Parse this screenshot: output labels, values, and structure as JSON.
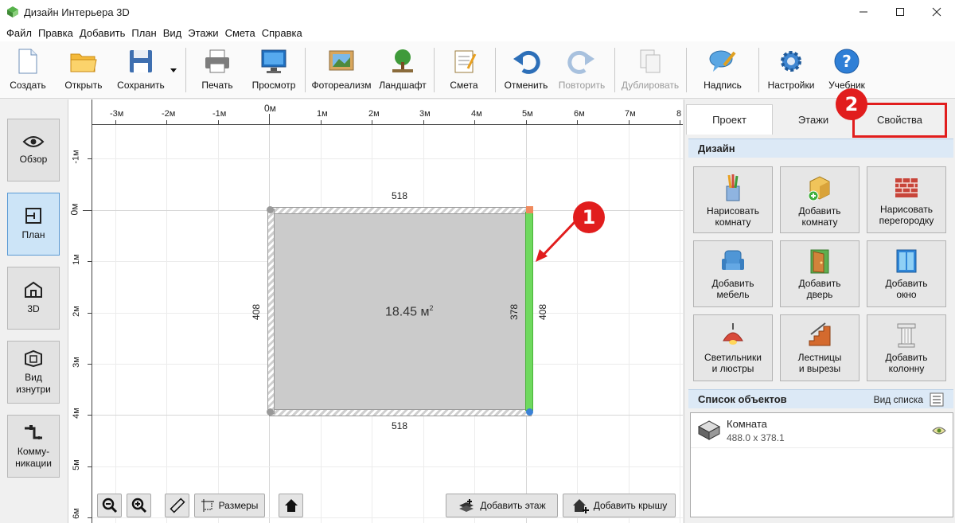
{
  "window": {
    "title": "Дизайн Интерьера 3D",
    "controls": [
      "minimize",
      "maximize",
      "close"
    ]
  },
  "menu": [
    "Файл",
    "Правка",
    "Добавить",
    "План",
    "Вид",
    "Этажи",
    "Смета",
    "Справка"
  ],
  "toolbar": {
    "create": "Создать",
    "open": "Открыть",
    "save": "Сохранить",
    "print": "Печать",
    "preview": "Просмотр",
    "photoreal": "Фотореализм",
    "landscape": "Ландшафт",
    "estimate": "Смета",
    "undo": "Отменить",
    "redo": "Повторить",
    "duplicate": "Дублировать",
    "caption": "Надпись",
    "settings": "Настройки",
    "tutorial": "Учебник"
  },
  "views": [
    {
      "label": "Обзор",
      "icon": "eye-icon",
      "active": false
    },
    {
      "label": "План",
      "icon": "plan-icon",
      "active": true
    },
    {
      "label": "3D",
      "icon": "house-3d-icon",
      "active": false
    },
    {
      "label": "Вид изнутри",
      "icon": "inside-view-icon",
      "active": false
    },
    {
      "label": "Комму-никации",
      "icon": "pipes-icon",
      "active": false
    }
  ],
  "ruler": {
    "h_labels": [
      "-3м",
      "-2м",
      "-1м",
      "0м",
      "1м",
      "2м",
      "3м",
      "4м",
      "5м",
      "6м",
      "7м",
      "8"
    ],
    "v_labels": [
      "-1м",
      "0м",
      "1м",
      "2м",
      "3м",
      "4м",
      "5м",
      "6м"
    ]
  },
  "plan": {
    "area": "18.45 м",
    "area_sup": "2",
    "dim_top": "518",
    "dim_bottom": "518",
    "dim_left": "408",
    "dim_right_inner": "378",
    "dim_right_outer": "408"
  },
  "annotations": {
    "callout1": "1",
    "callout2": "2"
  },
  "bottom_tools": {
    "dimensions": "Размеры",
    "add_floor": "Добавить этаж",
    "add_roof": "Добавить крышу"
  },
  "tabs": [
    {
      "label": "Проект",
      "active": true
    },
    {
      "label": "Этажи",
      "active": false
    },
    {
      "label": "Свойства",
      "active": false
    }
  ],
  "design": {
    "header": "Дизайн",
    "buttons": [
      {
        "label": "Нарисовать комнату",
        "icon": "pencils-icon"
      },
      {
        "label": "Добавить комнату",
        "icon": "add-room-icon"
      },
      {
        "label": "Нарисовать перегородку",
        "icon": "brick-wall-icon"
      },
      {
        "label": "Добавить мебель",
        "icon": "armchair-icon"
      },
      {
        "label": "Добавить дверь",
        "icon": "door-icon"
      },
      {
        "label": "Добавить окно",
        "icon": "window-icon"
      },
      {
        "label": "Светильники и люстры",
        "icon": "lamp-icon"
      },
      {
        "label": "Лестницы и вырезы",
        "icon": "stairs-icon"
      },
      {
        "label": "Добавить колонну",
        "icon": "column-icon"
      }
    ]
  },
  "objects": {
    "header": "Список объектов",
    "view_mode": "Вид списка",
    "items": [
      {
        "name": "Комната",
        "size": "488.0 x 378.1"
      }
    ]
  },
  "colors": {
    "accent": "#5b9bd5",
    "callout": "#e11d1d",
    "selected_wall": "#6fd95e",
    "room_floor": "#cbcbcb"
  }
}
